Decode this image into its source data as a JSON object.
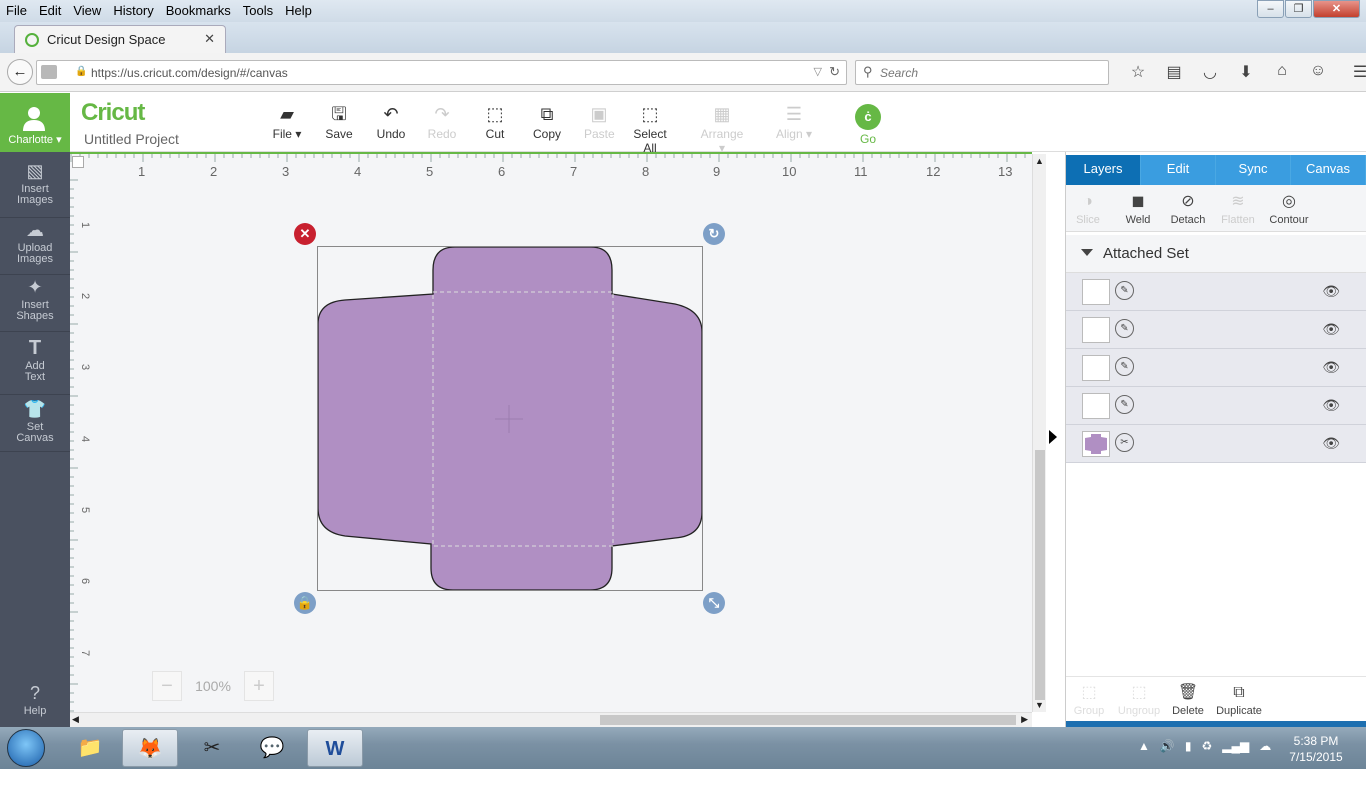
{
  "browser": {
    "menu": [
      "File",
      "Edit",
      "View",
      "History",
      "Bookmarks",
      "Tools",
      "Help"
    ],
    "tab_title": "Cricut Design Space",
    "url": "https://us.cricut.com/design/#/canvas",
    "search_placeholder": "Search"
  },
  "app": {
    "user": "Charlotte",
    "logo": "Cricut",
    "project_name": "Untitled Project",
    "toolbar": {
      "file": "File",
      "save": "Save",
      "undo": "Undo",
      "redo": "Redo",
      "cut": "Cut",
      "copy": "Copy",
      "paste": "Paste",
      "select_all": "Select All",
      "arrange": "Arrange",
      "align": "Align",
      "go": "Go"
    },
    "sidebar": {
      "insert_images": "Insert\nImages",
      "upload_images": "Upload\nImages",
      "insert_shapes": "Insert\nShapes",
      "add_text": "Add\nText",
      "set_canvas": "Set\nCanvas",
      "help": "Help"
    },
    "ruler_h": [
      "1",
      "2",
      "3",
      "4",
      "5",
      "6",
      "7",
      "8",
      "9",
      "10",
      "11",
      "12",
      "13"
    ],
    "ruler_v": [
      "1",
      "2",
      "3",
      "4",
      "5",
      "6",
      "7"
    ],
    "zoom": "100%",
    "panel": {
      "tabs": [
        "Layers",
        "Edit",
        "Sync",
        "Canvas"
      ],
      "tools": {
        "slice": "Slice",
        "weld": "Weld",
        "detach": "Detach",
        "flatten": "Flatten",
        "contour": "Contour"
      },
      "attached_set": "Attached Set",
      "bottom": {
        "group": "Group",
        "ungroup": "Ungroup",
        "delete": "Delete",
        "duplicate": "Duplicate"
      }
    },
    "colors": {
      "brand": "#66b845",
      "shape": "#b08fc3",
      "tab_blue": "#1d8ed7",
      "delete_red": "#c8202f"
    }
  },
  "taskbar": {
    "time": "5:38 PM",
    "date": "7/15/2015"
  }
}
